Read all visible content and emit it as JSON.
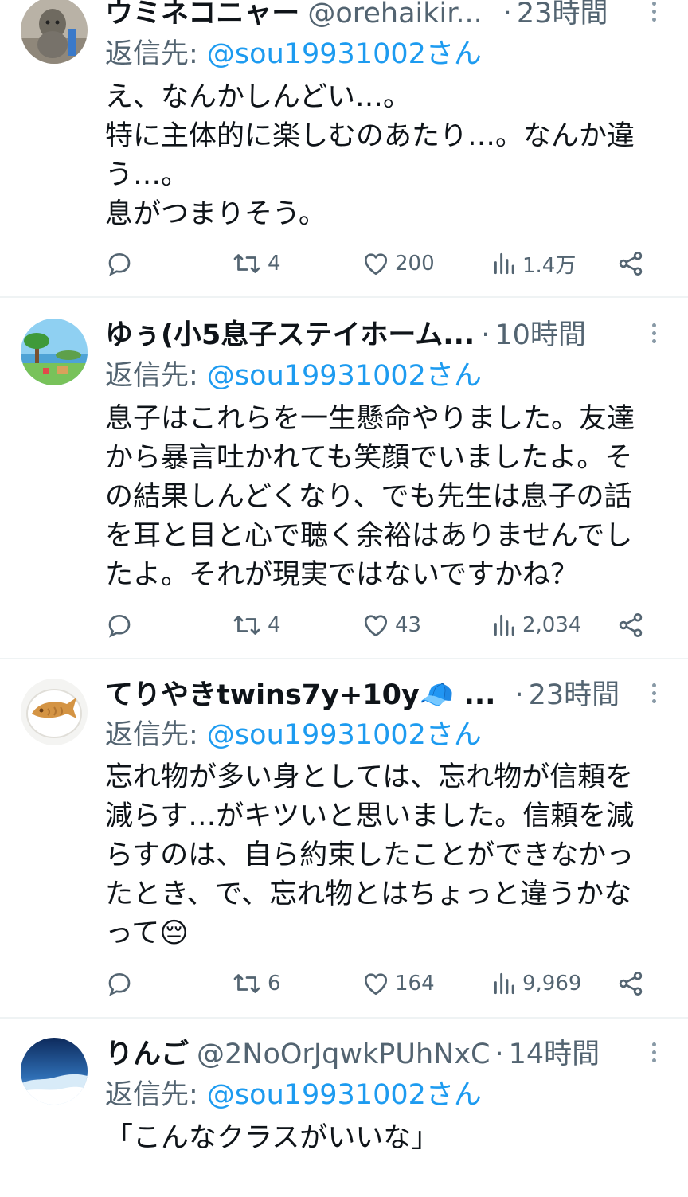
{
  "posts": [
    {
      "display_name": "ウミネコニャー",
      "handle": "@orehaikir...",
      "dot": "·",
      "time": "23時間",
      "reply_label": "返信先: ",
      "reply_handle": "@sou19931002さん",
      "text": "え、なんかしんどい…。\n特に主体的に楽しむのあたり…。なんか違\nう…。\n息がつまりそう。",
      "stats": {
        "retweets": "4",
        "likes": "200",
        "views": "1.4万"
      },
      "avatar": "crocheted-doll-avatar"
    },
    {
      "display_name": "ゆぅ(小5息子ステイホーム...",
      "handle": "",
      "dot": "·",
      "time": "10時間",
      "reply_label": "返信先: ",
      "reply_handle": "@sou19931002さん",
      "text": "息子はこれらを一生懸命やりました。友達\nから暴言吐かれても笑顔でいましたよ。そ\nの結果しんどくなり、でも先生は息子の話\nを耳と目と心で聴く余裕はありませんでし\nたよ。それが現実ではないですかね？",
      "stats": {
        "retweets": "4",
        "likes": "43",
        "views": "2,034"
      },
      "avatar": "island-landscape-avatar"
    },
    {
      "display_name": "てりやきtwins7y+10y🧢 ...",
      "handle": "",
      "dot": "·",
      "time": "23時間",
      "reply_label": "返信先: ",
      "reply_handle": "@sou19931002さん",
      "text": "忘れ物が多い身としては、忘れ物が信頼を\n減らす…がキツいと思いました。信頼を減\nらすのは、自ら約束したことができなかっ\nたとき、で、忘れ物とはちょっと違うかな\nって😔",
      "stats": {
        "retweets": "6",
        "likes": "164",
        "views": "9,969"
      },
      "avatar": "taiyaki-avatar"
    },
    {
      "display_name": "りんご",
      "handle": "@2NoOrJqwkPUhNxC",
      "dot": "·",
      "time": "14時間",
      "reply_label": "返信先: ",
      "reply_handle": "@sou19931002さん",
      "text": "「こんなクラスがいいな」",
      "avatar": "blue-sky-avatar"
    }
  ],
  "icons": {
    "reply": "reply-icon",
    "retweet": "retweet-icon",
    "like": "heart-icon",
    "views": "views-icon",
    "share": "share-icon",
    "more": "more-icon"
  },
  "colors": {
    "text": "#0f1419",
    "secondary": "#536471",
    "link": "#1d9bf0",
    "divider": "#eff3f4"
  }
}
